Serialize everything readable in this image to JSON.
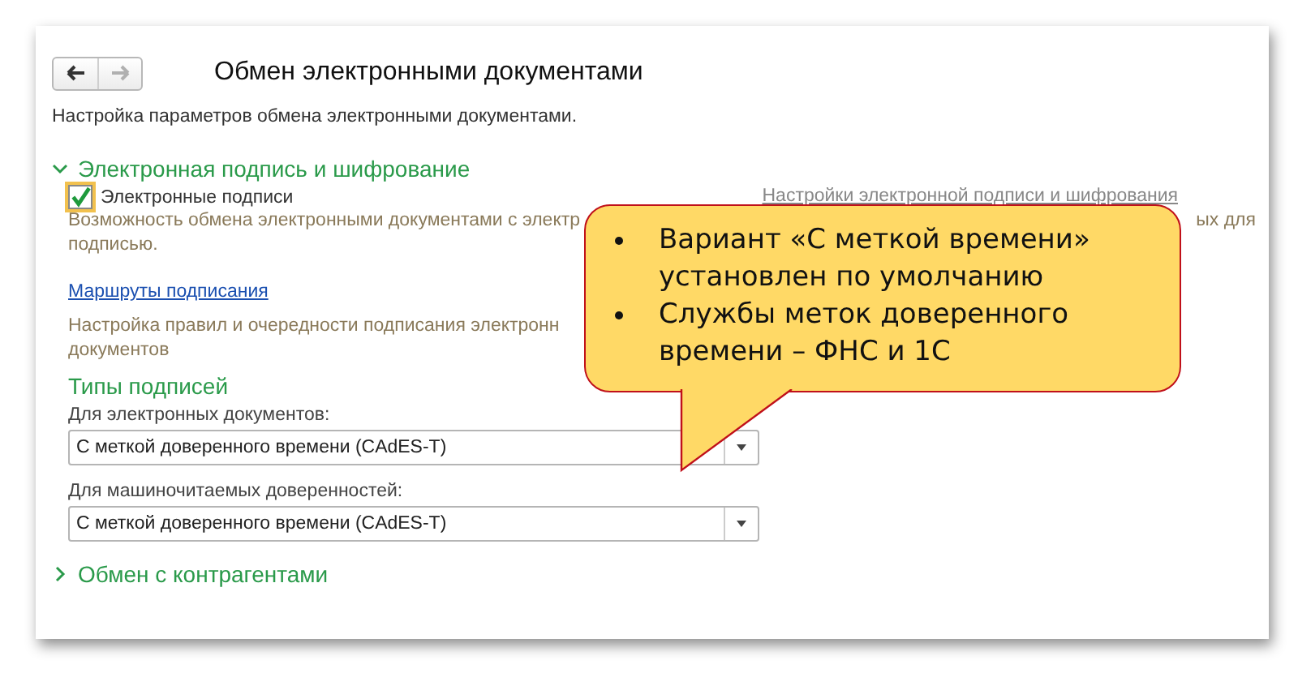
{
  "window": {
    "title": "Обмен электронными документами",
    "nav": [
      {
        "kind": "back",
        "disabled": false
      },
      {
        "kind": "forward",
        "disabled": true
      }
    ]
  },
  "description": "Настройка параметров обмена электронными документами.",
  "sections": [
    {
      "title": "Электронная подпись и шифрование",
      "expanded": true,
      "checkbox": {
        "label": "Электронные подписи",
        "checked": true,
        "focused": true
      },
      "settings_link": "Настройки электронной подписи и шифрования",
      "checkbox_note": [
        "Возможность обмена электронными документами с электр",
        "подписью."
      ],
      "settings_note": "ых для",
      "routes_link": "Маршруты подписания",
      "routes_note": [
        "Настройка правил и очередности подписания электронн",
        "документов"
      ],
      "subsection": "Типы подписей",
      "fields": [
        {
          "label": "Для электронных документов:",
          "value": "С меткой доверенного времени (CAdES-T)"
        },
        {
          "label": "Для машиночитаемых доверенностей:",
          "value": "С меткой доверенного времени (CAdES-T)"
        }
      ]
    },
    {
      "title": "Обмен с контрагентами",
      "expanded": false
    }
  ],
  "callout": {
    "bullets": [
      "Вариант «С меткой времени» установлен по умолчанию",
      "Службы меток доверенного времени – ФНС и 1С"
    ]
  }
}
